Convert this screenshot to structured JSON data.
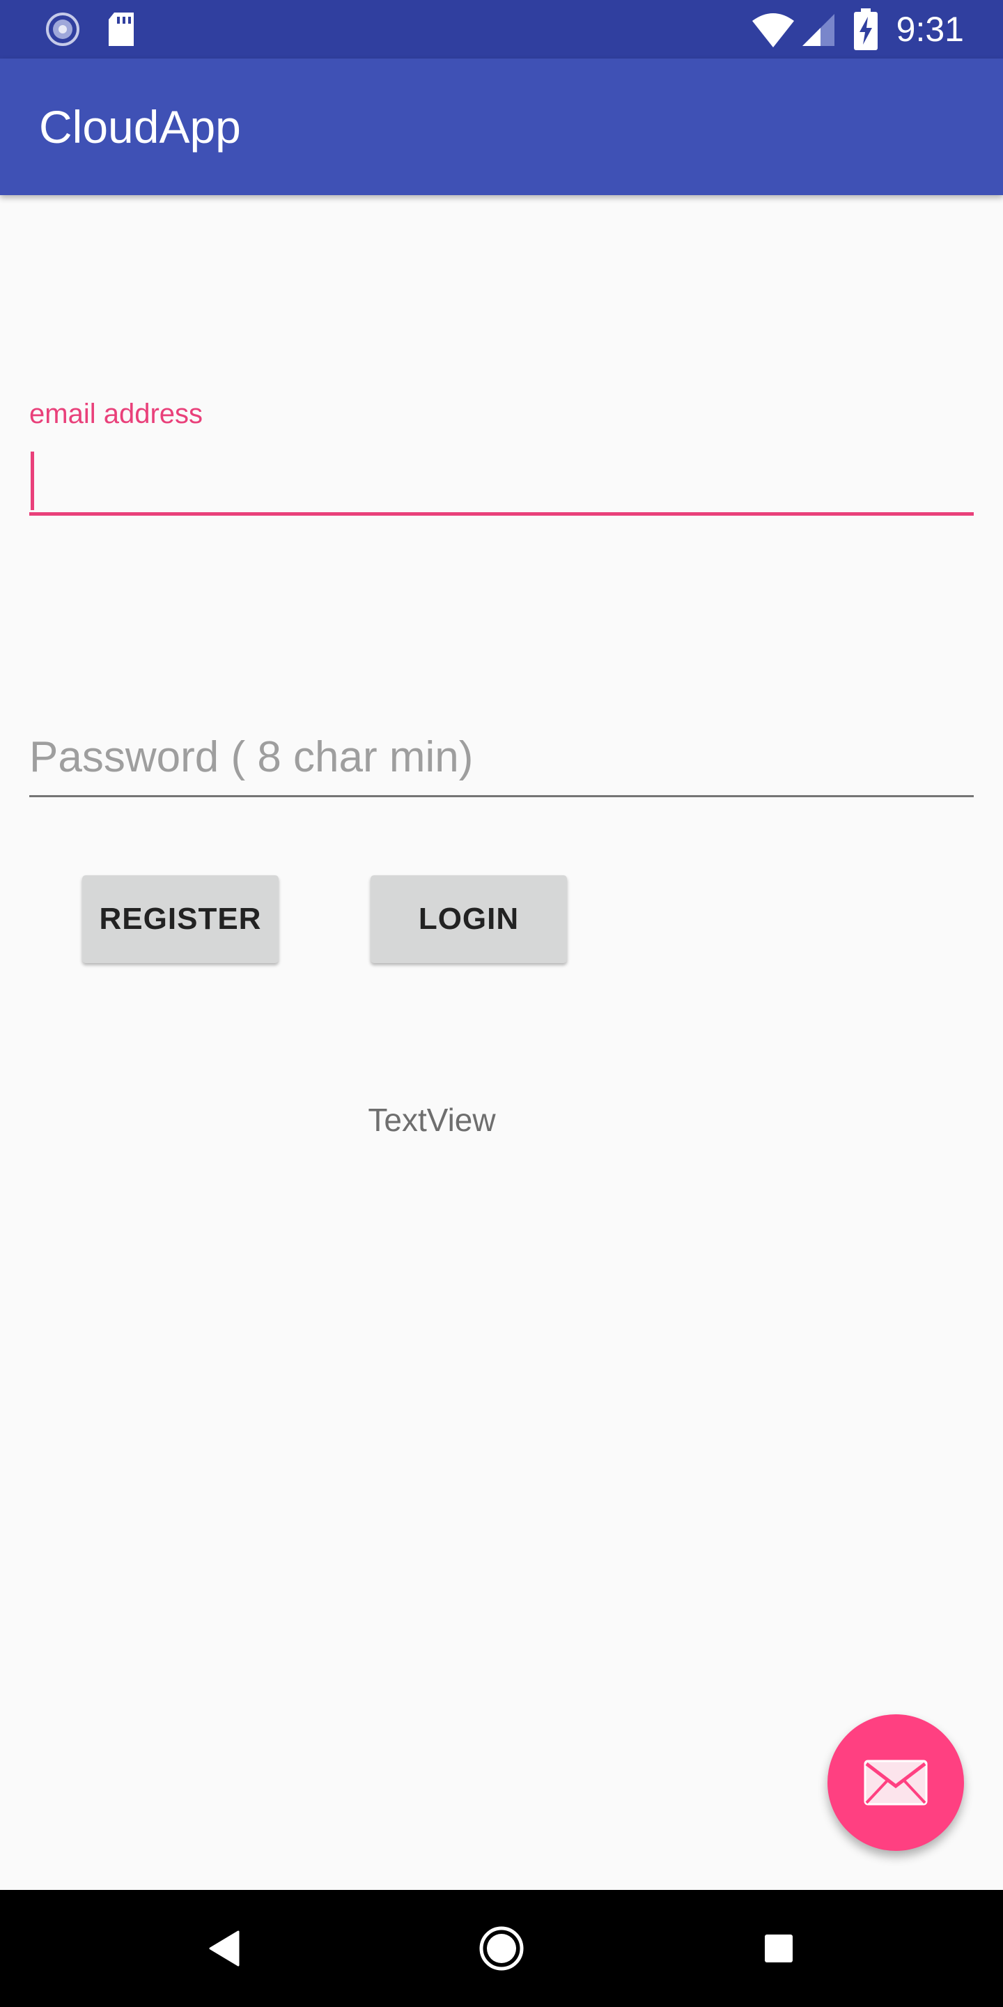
{
  "status_bar": {
    "time": "9:31",
    "icons": [
      "sync-icon",
      "sd-card-icon",
      "wifi-icon",
      "cell-signal-icon",
      "battery-charging-icon"
    ]
  },
  "app_bar": {
    "title": "CloudApp",
    "color": "#3f51b5",
    "status_color": "#303f9f"
  },
  "form": {
    "email": {
      "label": "email address",
      "value": "",
      "accent_color": "#e9407a"
    },
    "password": {
      "placeholder": "Password ( 8 char min)",
      "value": ""
    }
  },
  "buttons": {
    "register_label": "REGISTER",
    "login_label": "LOGIN"
  },
  "textview": {
    "text": "TextView"
  },
  "fab": {
    "icon": "mail-icon",
    "color": "#ff4081"
  },
  "nav_bar": {
    "icons": [
      "back-icon",
      "home-icon",
      "recents-icon"
    ]
  }
}
